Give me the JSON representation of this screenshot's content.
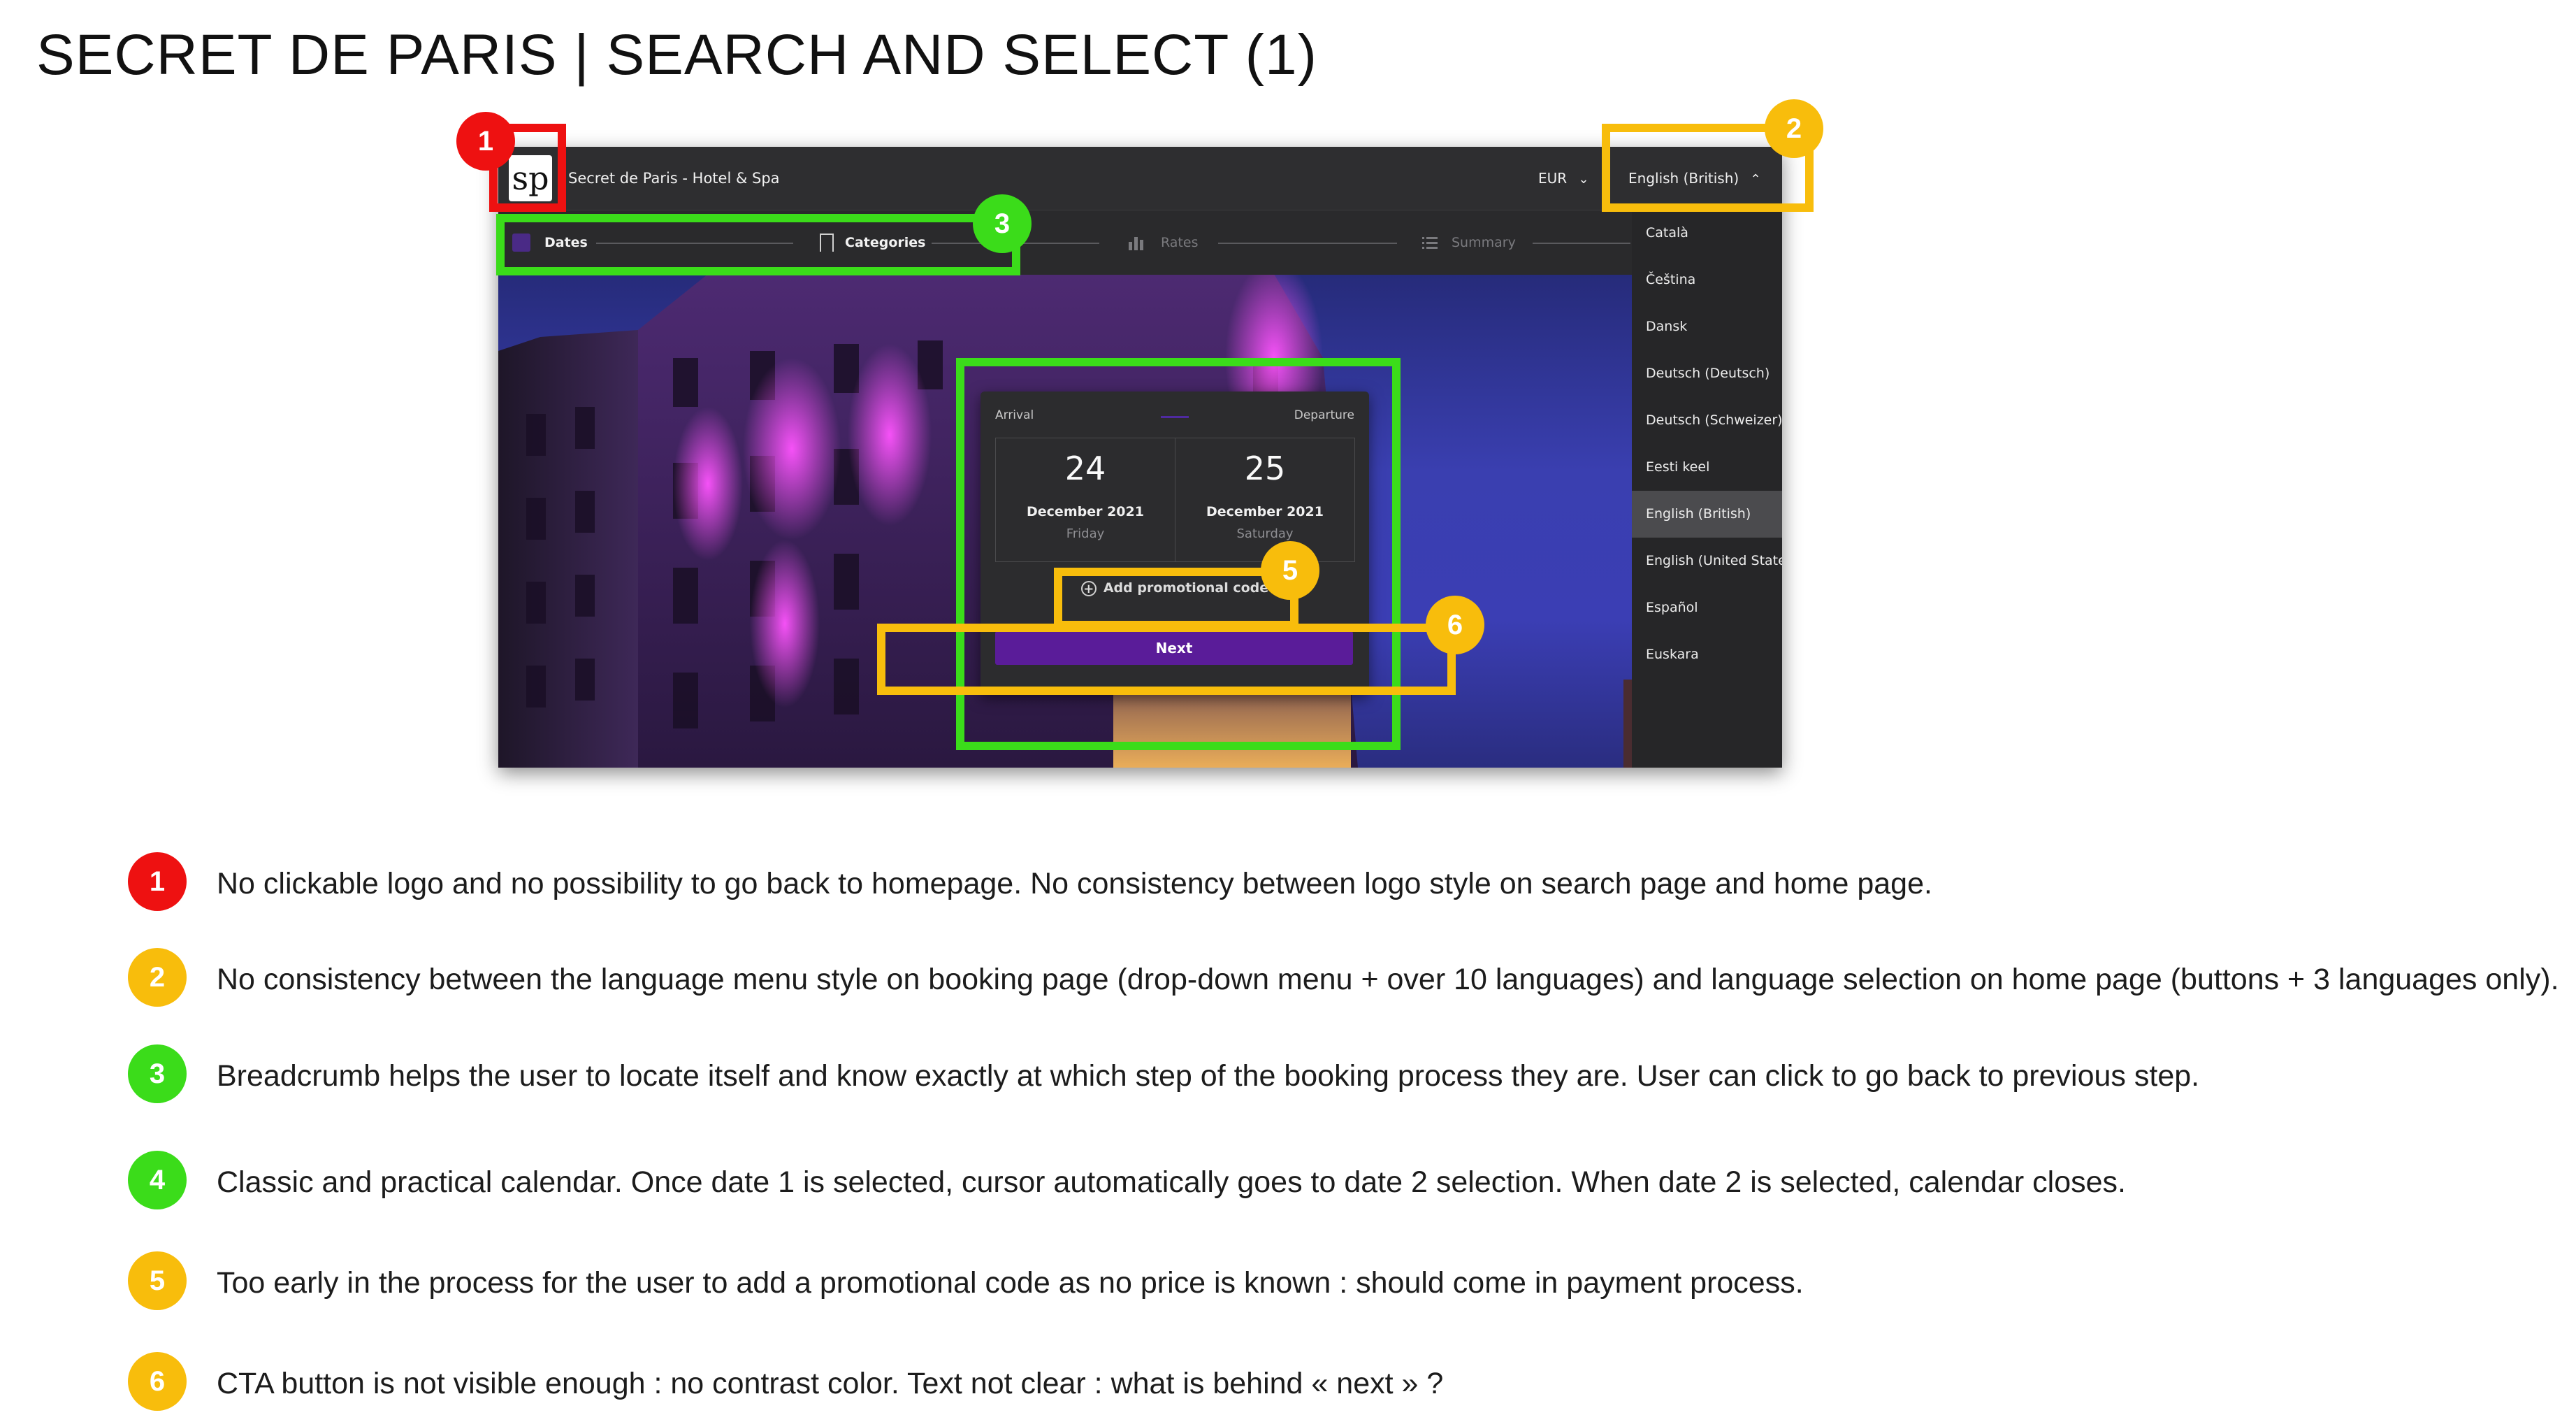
{
  "title": "SECRET DE PARIS | SEARCH AND SELECT (1)",
  "app": {
    "logo_text": "sp",
    "hotel_name": "Secret de Paris - Hotel & Spa",
    "currency": "EUR",
    "language": "English (British)"
  },
  "steps": [
    {
      "label": "Dates"
    },
    {
      "label": "Categories"
    },
    {
      "label": "Rates"
    },
    {
      "label": "Summary"
    }
  ],
  "languages": [
    {
      "label": "Català"
    },
    {
      "label": "Čeština"
    },
    {
      "label": "Dansk"
    },
    {
      "label": "Deutsch (Deutsch)"
    },
    {
      "label": "Deutsch (Schweizer)"
    },
    {
      "label": "Eesti keel"
    },
    {
      "label": "English (British)",
      "selected": true
    },
    {
      "label": "English (United States)"
    },
    {
      "label": "Español"
    },
    {
      "label": "Euskara"
    }
  ],
  "booking": {
    "arrival_label": "Arrival",
    "departure_label": "Departure",
    "arrival": {
      "day": "24",
      "month": "December 2021",
      "weekday": "Friday"
    },
    "departure": {
      "day": "25",
      "month": "December 2021",
      "weekday": "Saturday"
    },
    "promo_label": "Add promotional code",
    "next_label": "Next"
  },
  "markers": [
    "1",
    "2",
    "3",
    "5",
    "6"
  ],
  "notes": [
    {
      "num": "1",
      "color": "red",
      "text": "No clickable logo and no possibility to go back to homepage. No consistency between logo style on search page and home page."
    },
    {
      "num": "2",
      "color": "yellow",
      "text": "No consistency between the language menu style on booking page (drop-down menu + over 10 languages) and language selection on home page (buttons + 3 languages only)."
    },
    {
      "num": "3",
      "color": "green",
      "text": "Breadcrumb helps the user to locate itself and know exactly at which step of the booking process they are. User can click to go back to previous step."
    },
    {
      "num": "4",
      "color": "green",
      "text": "Classic and practical calendar. Once date 1 is selected, cursor automatically goes to date 2 selection. When date 2 is selected, calendar closes."
    },
    {
      "num": "5",
      "color": "yellow",
      "text": "Too early in the process for the user to add a promotional code as no price is known : should come in payment process."
    },
    {
      "num": "6",
      "color": "yellow",
      "text": "CTA button is not visible enough : no contrast color. Text not clear : what is behind « next » ?"
    }
  ],
  "colors": {
    "red": "#ee1111",
    "yellow": "#f8bd0c",
    "green": "#3bdc1a",
    "cta": "#5a1c99"
  }
}
